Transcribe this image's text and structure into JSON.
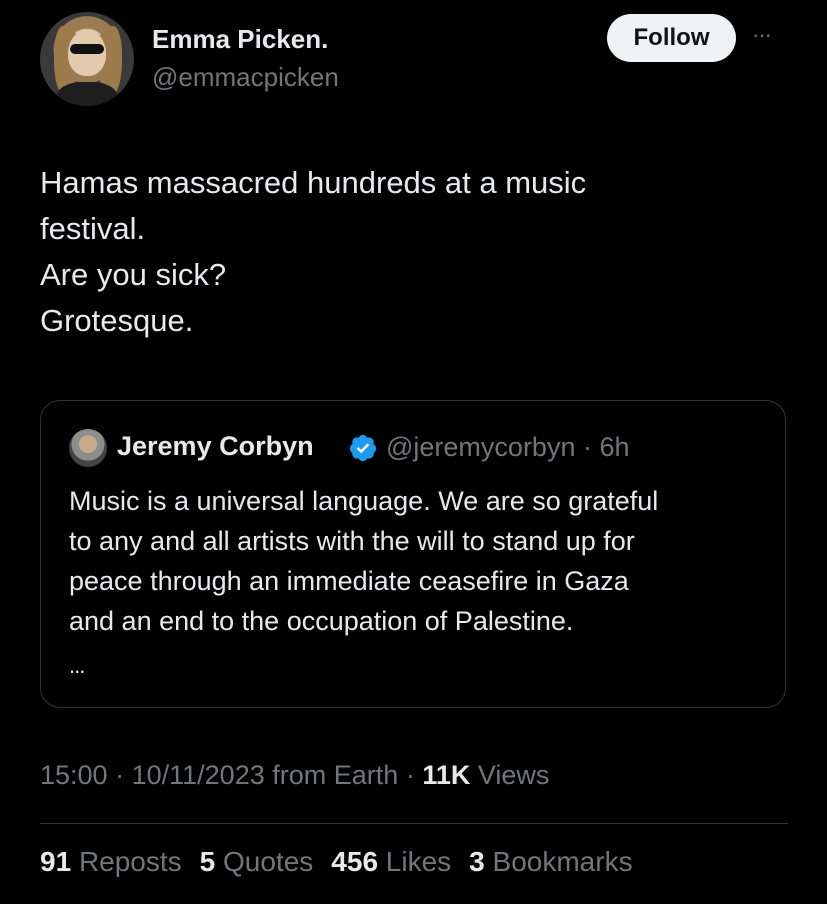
{
  "author": {
    "name": "Emma Picken.",
    "handle": "@emmacpicken"
  },
  "follow_label": "Follow",
  "more_label": "···",
  "tweet_lines": [
    "Hamas massacred hundreds at a music",
    "festival.",
    "Are you sick?",
    "Grotesque."
  ],
  "quote": {
    "name": "Jeremy Corbyn",
    "handle_time": "@jeremycorbyn · 6h",
    "lines": [
      "Music is a universal language. We are so grateful",
      "to any and all artists with the will to stand up for",
      "peace through an immediate ceasefire in Gaza",
      "and an end to the occupation of Palestine."
    ],
    "ellipsis": "...",
    "verified_color": "#1d9bf0"
  },
  "meta": {
    "time": "15:00",
    "date": "10/11/2023",
    "source": "from Earth",
    "views_count": "11K",
    "views_label": "Views"
  },
  "stats": {
    "reposts_count": "91",
    "reposts_label": "Reposts",
    "quotes_count": "5",
    "quotes_label": "Quotes",
    "likes_count": "456",
    "likes_label": "Likes",
    "bookmarks_count": "3",
    "bookmarks_label": "Bookmarks"
  },
  "icons": [
    "avatar",
    "verified-icon",
    "more-icon"
  ]
}
